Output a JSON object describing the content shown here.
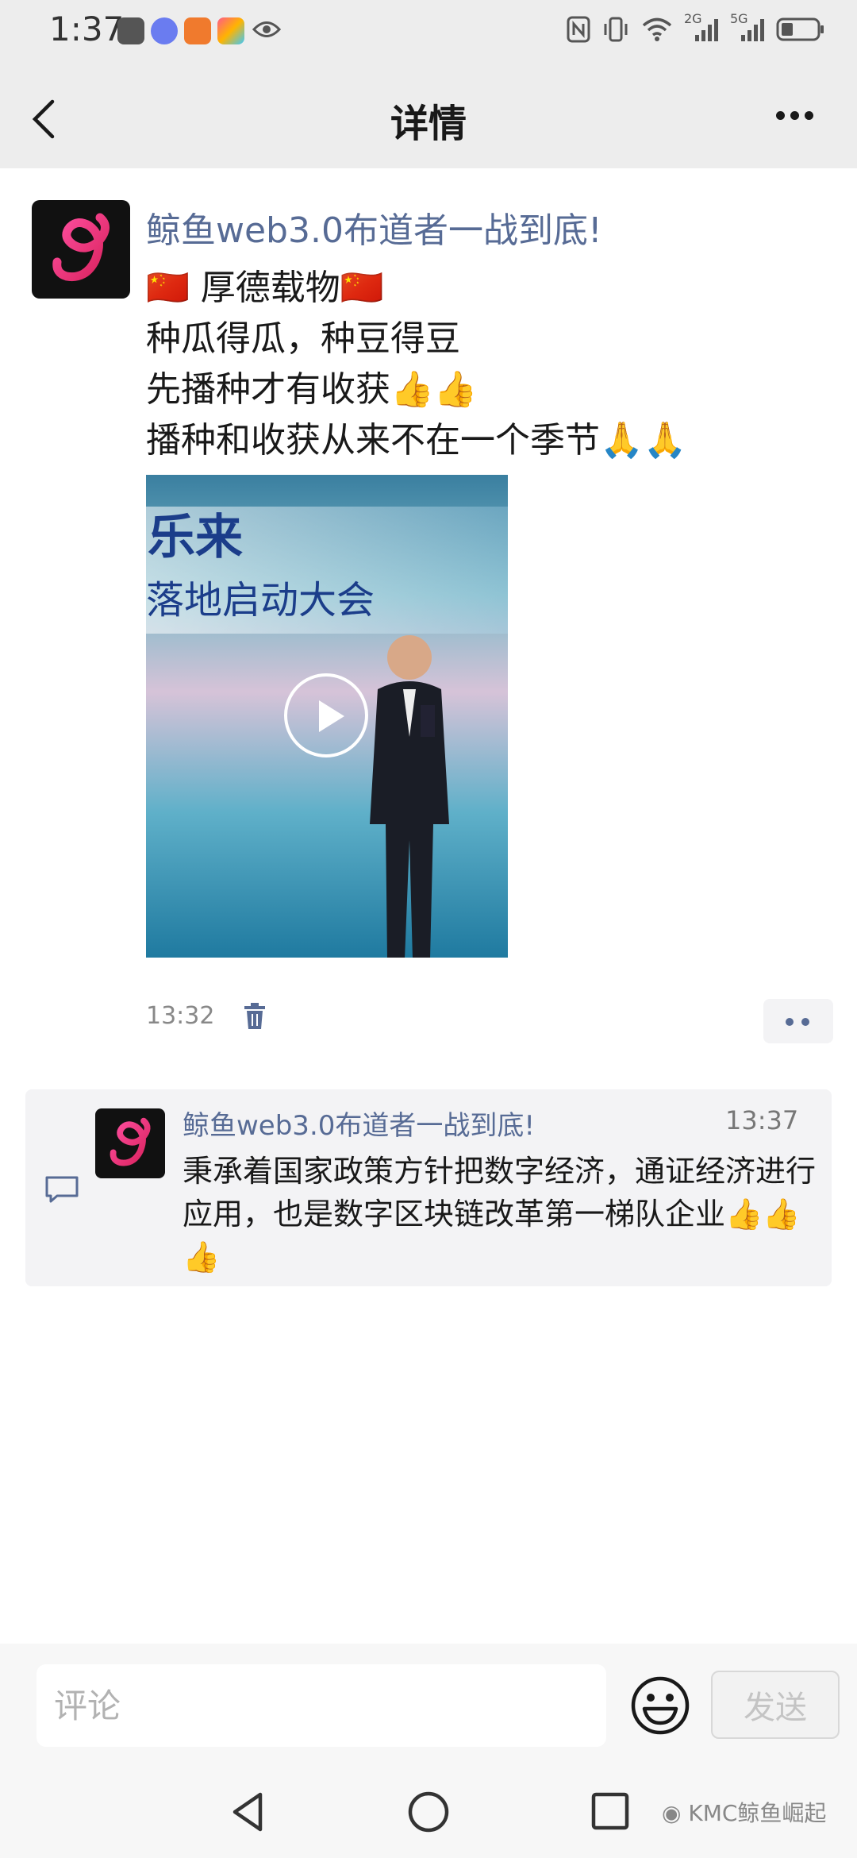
{
  "status_bar": {
    "time": "1:37",
    "net1": "2G",
    "net2": "5G"
  },
  "nav": {
    "title": "详情"
  },
  "post": {
    "author": "鲸鱼web3.0布道者一战到底!",
    "lines": [
      "🇨🇳 厚德载物🇨🇳",
      "种瓜得瓜，种豆得豆",
      "先播种才有收获👍👍",
      "播种和收获从来不在一个季节🙏🙏"
    ],
    "video_caption_1": "乐来",
    "video_caption_2": "落地启动大会",
    "time": "13:32"
  },
  "comments": [
    {
      "author": "鲸鱼web3.0布道者一战到底!",
      "time": "13:37",
      "text": "秉承着国家政策方针把数字经济，通证经济进行应用，也是数字区块链改革第一梯队企业👍👍👍"
    }
  ],
  "input": {
    "placeholder": "评论",
    "send_label": "发送"
  },
  "watermark": "KMC鲸鱼崛起",
  "colors": {
    "link_blue": "#576b95",
    "bar_gray": "#ededed"
  }
}
